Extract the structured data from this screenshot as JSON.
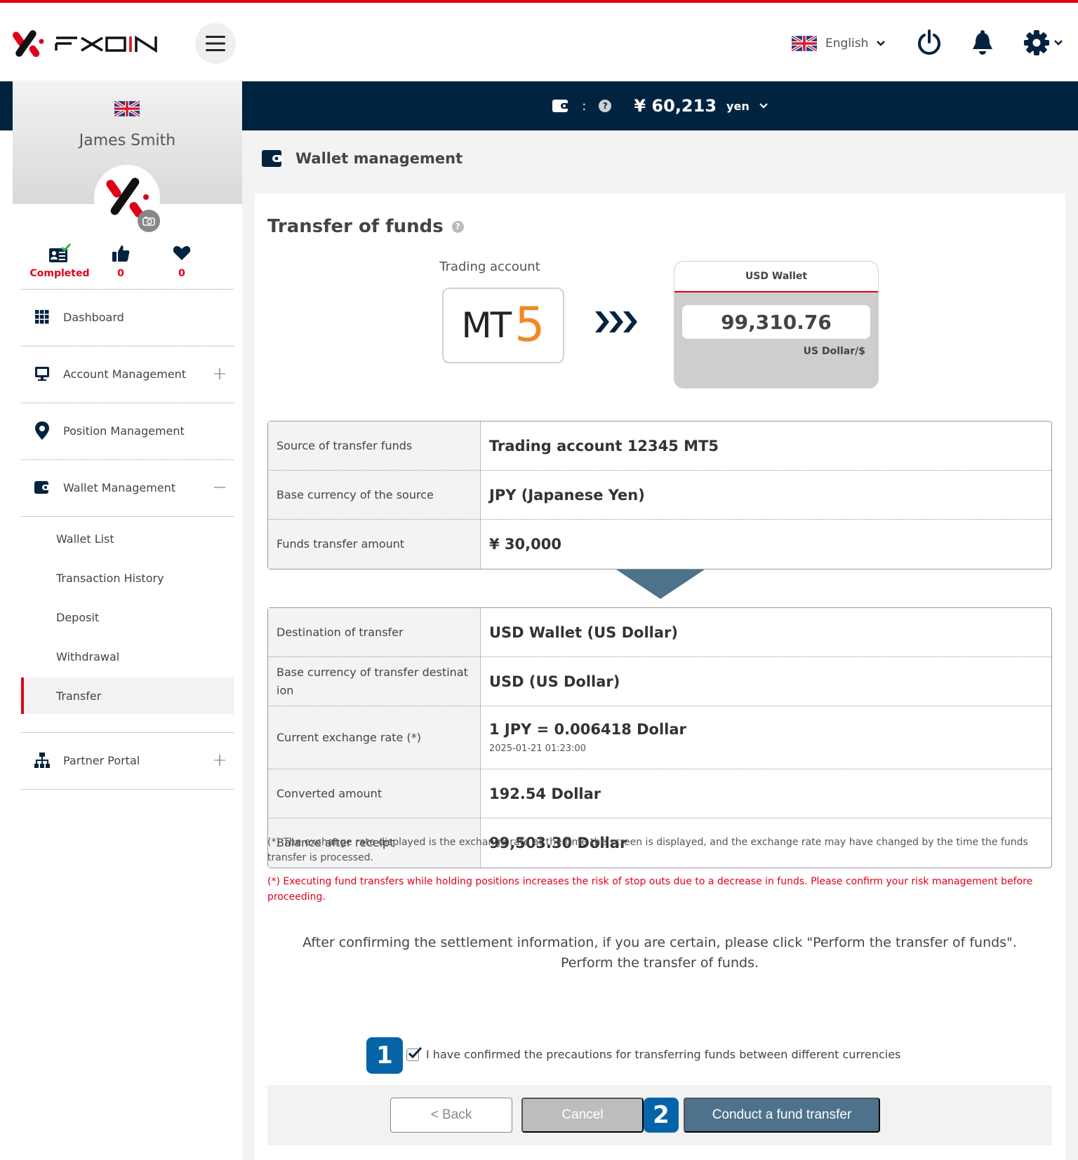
{
  "header": {
    "brand": "FXON",
    "language": "English",
    "icons": [
      "hamburger-menu-icon",
      "uk-flag-icon",
      "chevron-down-icon",
      "power-icon",
      "bell-icon",
      "gear-icon"
    ]
  },
  "balance_bar": {
    "colon": ":",
    "amount": "¥ 60,213",
    "unit": "yen"
  },
  "profile": {
    "name": "James Smith",
    "stats": [
      {
        "icon": "id-card-check-icon",
        "value": "Completed"
      },
      {
        "icon": "thumbs-up-icon",
        "value": "0"
      },
      {
        "icon": "heart-icon",
        "value": "0"
      }
    ]
  },
  "sidebar": {
    "items": [
      {
        "label": "Dashboard",
        "icon": "grid-icon",
        "toggle": ""
      },
      {
        "label": "Account Management",
        "icon": "monitor-icon",
        "toggle": "+"
      },
      {
        "label": "Position Management",
        "icon": "map-pin-icon",
        "toggle": ""
      },
      {
        "label": "Wallet Management",
        "icon": "wallet-icon",
        "toggle": "−"
      },
      {
        "label": "Partner Portal",
        "icon": "sitemap-icon",
        "toggle": "+"
      }
    ],
    "wallet_sub": [
      "Wallet List",
      "Transaction History",
      "Deposit",
      "Withdrawal",
      "Transfer"
    ],
    "active_sub": "Transfer"
  },
  "page": {
    "section_title": "Wallet management",
    "card_title": "Transfer of funds"
  },
  "transfer_visual": {
    "source_label": "Trading account",
    "source_platform_text": "MT",
    "source_platform_num": "5",
    "dest_title": "USD Wallet",
    "dest_amount": "99,310.76",
    "dest_currency": "US Dollar/$"
  },
  "source_table": [
    {
      "key": "Source of transfer funds",
      "value": "Trading account 12345 MT5"
    },
    {
      "key": "Base currency of the source",
      "value": "JPY (Japanese Yen)"
    },
    {
      "key": "Funds transfer amount",
      "value": "¥ 30,000"
    }
  ],
  "dest_table": [
    {
      "key": "Destination of transfer",
      "value": "USD Wallet (US Dollar)",
      "sub": ""
    },
    {
      "key": "Base currency of transfer destinat ion",
      "value": "USD (US Dollar)",
      "sub": ""
    },
    {
      "key": "Current exchange rate (*)",
      "value": "1 JPY = 0.006418 Dollar",
      "sub": "2025-01-21 01:23:00"
    },
    {
      "key": "Converted amount",
      "value": "192.54 Dollar",
      "sub": ""
    },
    {
      "key": "Balance after receipt",
      "value": "99,503.30 Dollar",
      "sub": ""
    }
  ],
  "notes": {
    "rate_note": "(*)  The exchange rate displayed is the exchange rate at the time the screen is displayed, and the exchange rate may have changed by the time the funds transfer is processed.",
    "risk_note": "(*)  Executing fund transfers while holding positions increases the risk of stop outs due to a decrease in funds. Please confirm your risk management before proceeding."
  },
  "confirm": {
    "line1": "After confirming the settlement information, if you are certain, please click \"Perform the transfer of funds\".",
    "line2": "Perform the transfer of funds.",
    "checkbox_label": "I have confirmed the precautions for transferring funds between different currencies",
    "checkbox_checked": true,
    "badge1": "1",
    "badge2": "2"
  },
  "buttons": {
    "back": "< Back",
    "cancel": "Cancel",
    "submit": "Conduct a fund transfer"
  },
  "colors": {
    "brand_red": "#e0001a",
    "navy": "#00233f",
    "mt5_orange": "#f08a24",
    "badge_blue": "#0564a8",
    "submit_button": "#4e728b"
  }
}
